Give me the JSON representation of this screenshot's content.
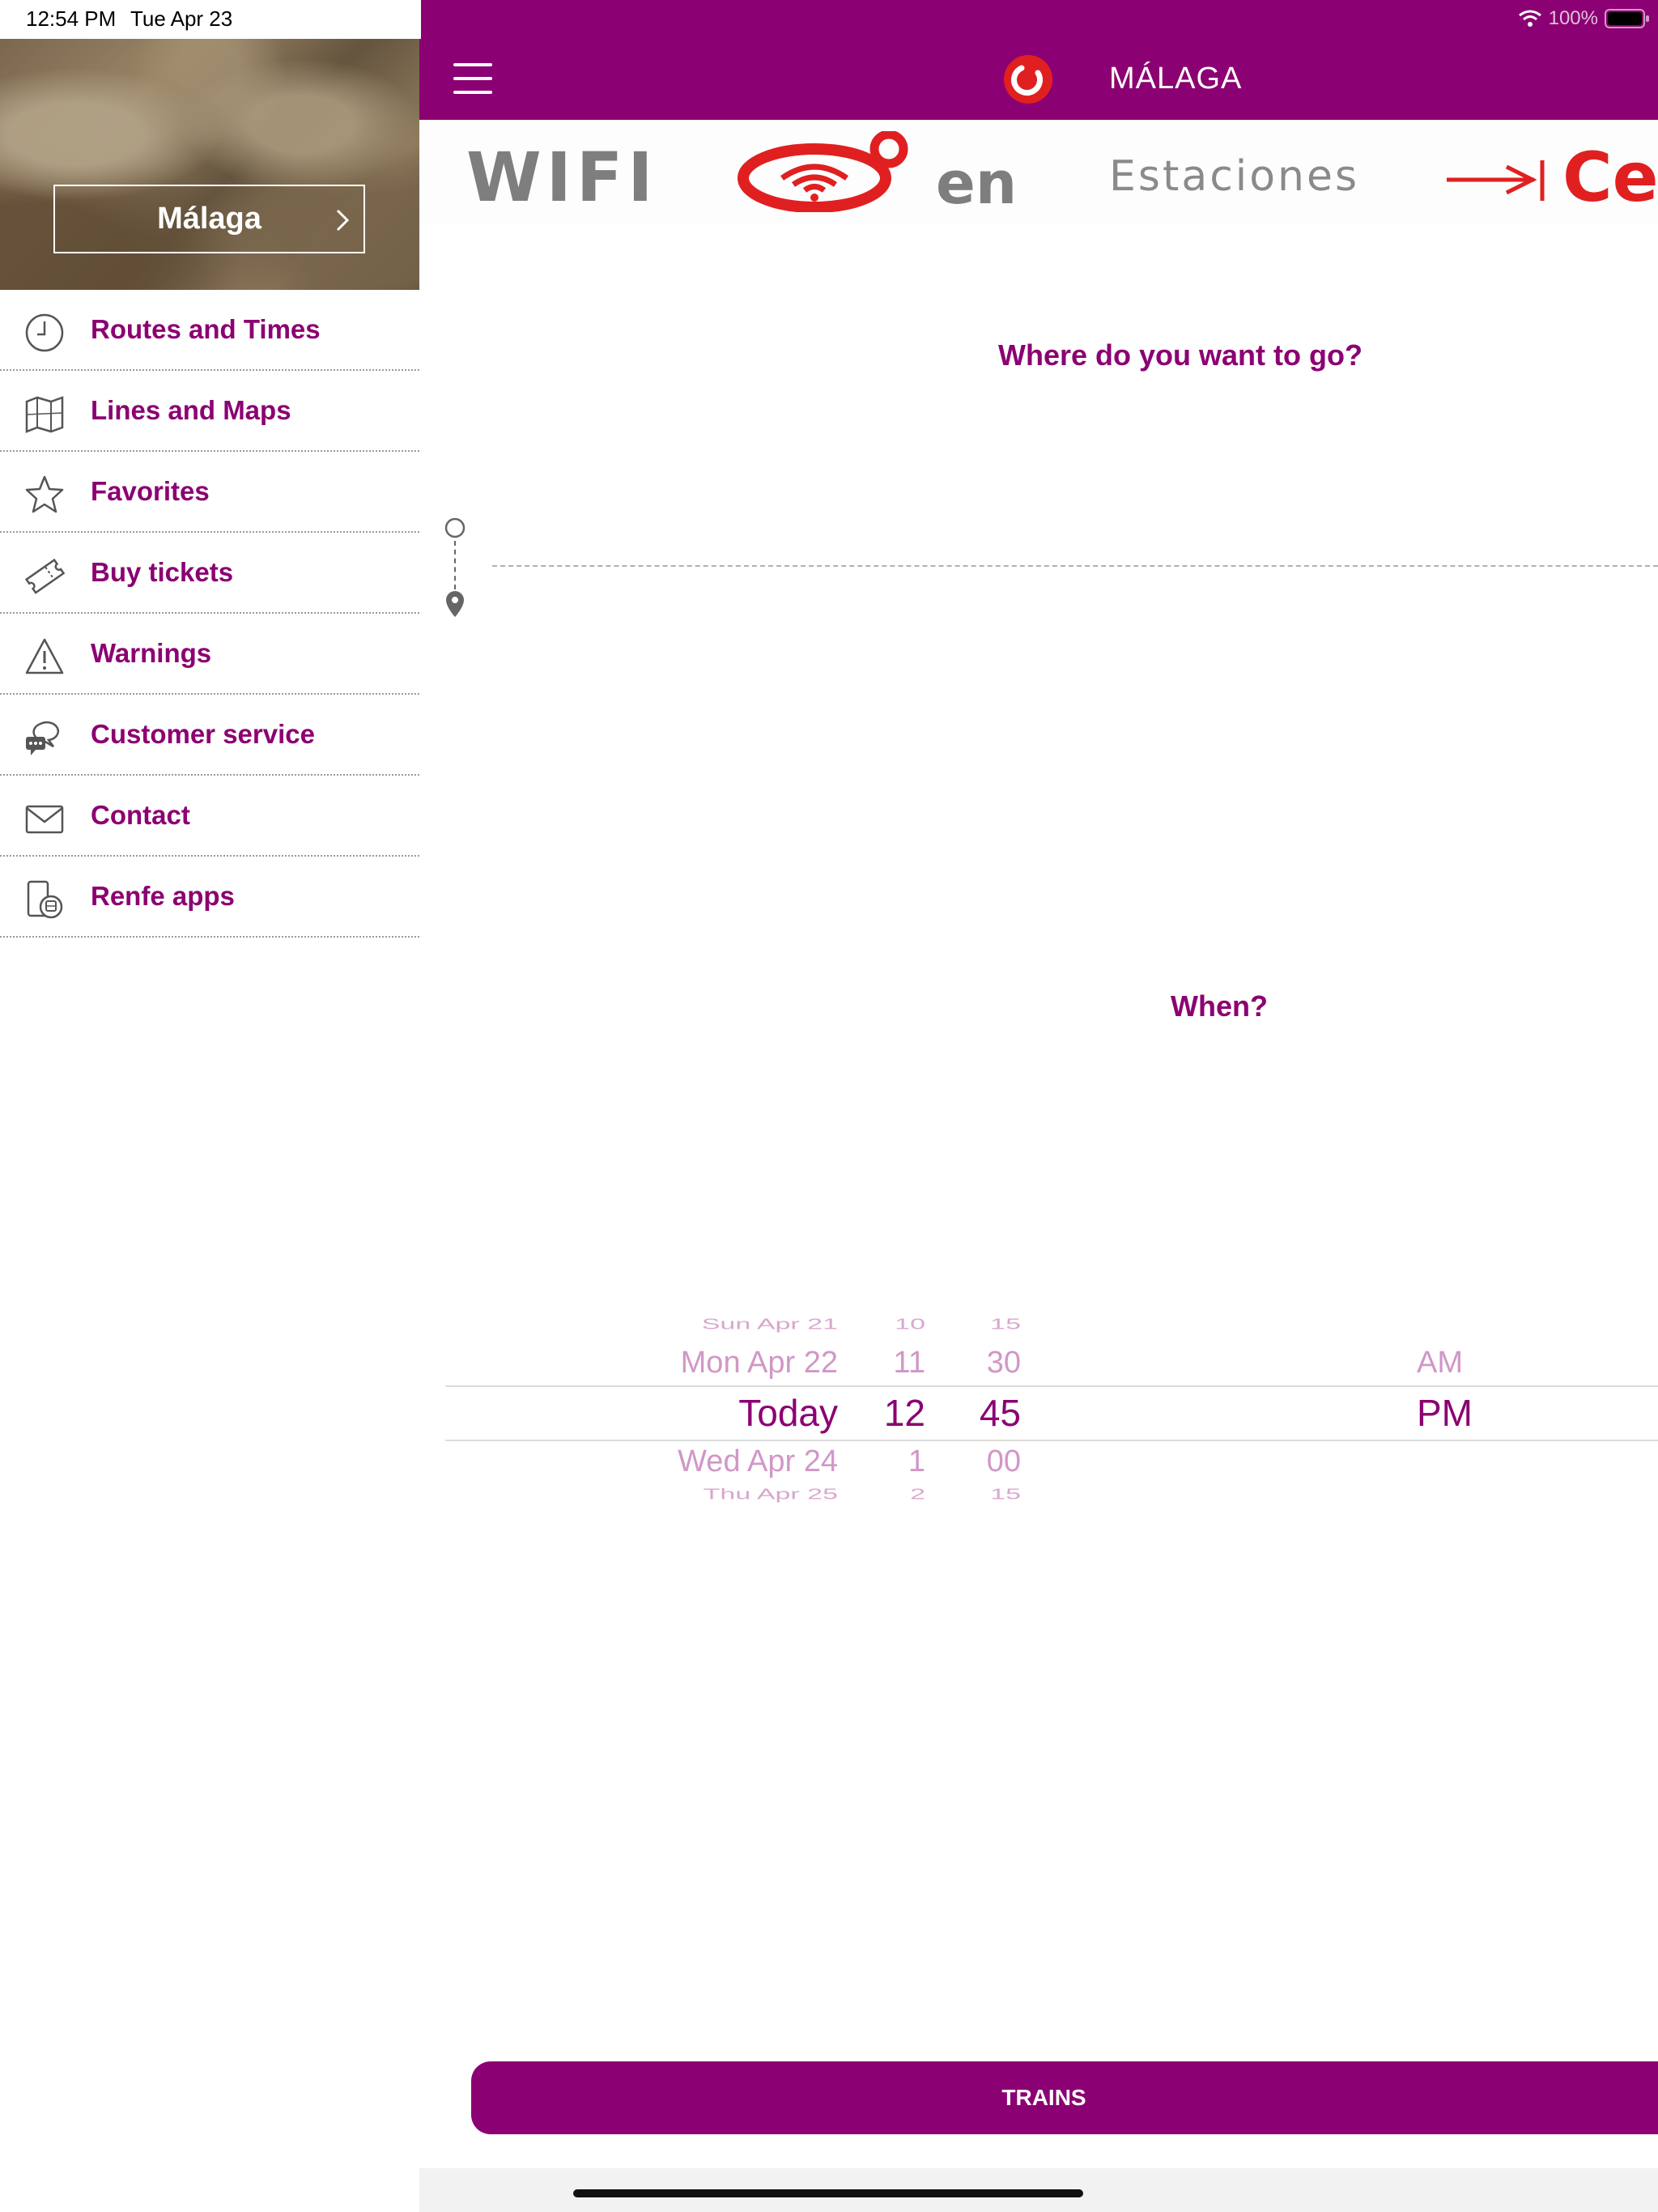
{
  "status_bar": {
    "time": "12:54 PM",
    "date": "Tue Apr 23",
    "battery_percent": "100%",
    "icons": [
      "wifi-icon",
      "battery-icon"
    ]
  },
  "sidebar": {
    "city": "Málaga",
    "items": [
      {
        "label": "Routes and Times",
        "icon": "clock-icon"
      },
      {
        "label": "Lines and Maps",
        "icon": "map-icon"
      },
      {
        "label": "Favorites",
        "icon": "star-icon"
      },
      {
        "label": "Buy tickets",
        "icon": "ticket-icon"
      },
      {
        "label": "Warnings",
        "icon": "warning-icon"
      },
      {
        "label": "Customer service",
        "icon": "chat-icon"
      },
      {
        "label": "Contact",
        "icon": "envelope-icon"
      },
      {
        "label": "Renfe apps",
        "icon": "phone-train-icon"
      }
    ]
  },
  "header": {
    "title": "MÁLAGA",
    "icons": [
      "menu-icon",
      "renfe-logo"
    ]
  },
  "banner": {
    "word1": "WIFI",
    "word2": "en",
    "word3": "Estaciones",
    "word4": "Ce"
  },
  "main": {
    "where_title": "Where do you want to go?",
    "when_title": "When?",
    "origin_value": "",
    "destination_value": ""
  },
  "picker": {
    "dates": [
      "Sun Apr 21",
      "Mon Apr 22",
      "Today",
      "Wed Apr 24",
      "Thu Apr 25"
    ],
    "hours": [
      "10",
      "11",
      "12",
      "1",
      "2"
    ],
    "minutes": [
      "15",
      "30",
      "45",
      "00",
      "15"
    ],
    "ampm": [
      "AM",
      "PM"
    ],
    "selected": {
      "date": "Today",
      "hour": "12",
      "minute": "45",
      "ampm": "PM"
    }
  },
  "actions": {
    "trains_label": "TRAINS"
  },
  "colors": {
    "brand": "#8b0072",
    "accent_red": "#e02020",
    "picker_faded": "#d197c6"
  }
}
